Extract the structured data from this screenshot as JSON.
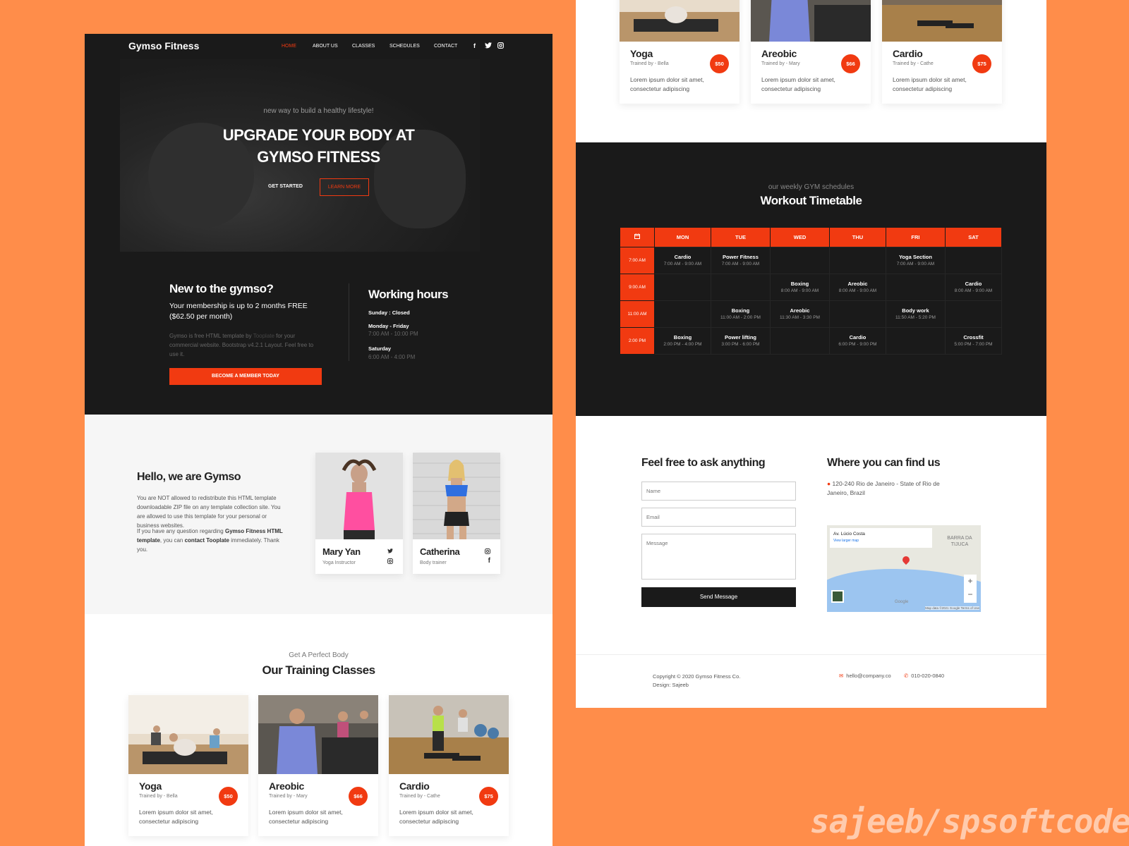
{
  "brand": "Gymso Fitness",
  "nav": {
    "items": [
      "HOME",
      "ABOUT US",
      "CLASSES",
      "SCHEDULES",
      "CONTACT"
    ],
    "social_icons": [
      "facebook-icon",
      "twitter-icon",
      "instagram-icon"
    ]
  },
  "hero": {
    "tagline": "new way to build a healthy lifestyle!",
    "title_line1": "UPGRADE YOUR BODY AT",
    "title_line2": "GYMSO FITNESS",
    "get_started": "GET STARTED",
    "learn_more": "LEARN MORE"
  },
  "membership": {
    "title": "New to the gymso?",
    "subtitle": "Your membership is up to 2 months FREE ($62.50 per month)",
    "desc_pre": "Gymso is free HTML template by ",
    "desc_link": "Tooplate",
    "desc_post": " for your commercial website. Bootstrap v4.2.1 Layout. Feel free to use it.",
    "button": "BECOME A MEMBER TODAY"
  },
  "hours": {
    "title": "Working hours",
    "sunday": "Sunday : Closed",
    "weekday_label": "Monday - Friday",
    "weekday_time": "7:00 AM - 10:00 PM",
    "saturday_label": "Saturday",
    "saturday_time": "6:00 AM - 4:00 PM"
  },
  "about": {
    "title": "Hello, we are Gymso",
    "p1": "You are NOT allowed to redistribute this HTML template downloadable ZIP file on any template collection site. You are allowed to use this template for your personal or business websites.",
    "p2_a": "If you have any question regarding ",
    "p2_b": "Gymso Fitness HTML template",
    "p2_c": ", you can ",
    "p2_d": "contact Tooplate",
    "p2_e": " immediately. Thank you.",
    "trainers": [
      {
        "name": "Mary Yan",
        "role": "Yoga Instructor",
        "icons": [
          "twitter-icon",
          "instagram-icon"
        ]
      },
      {
        "name": "Catherina",
        "role": "Body trainer",
        "icons": [
          "instagram-icon",
          "facebook-icon"
        ]
      }
    ]
  },
  "classes": {
    "subtitle": "Get A Perfect Body",
    "title": "Our Training Classes",
    "items": [
      {
        "name": "Yoga",
        "trainer": "Trained by - Bella",
        "price": "$50",
        "desc": "Lorem ipsum dolor sit amet, consectetur adipiscing"
      },
      {
        "name": "Areobic",
        "trainer": "Trained by - Mary",
        "price": "$66",
        "desc": "Lorem ipsum dolor sit amet, consectetur adipiscing"
      },
      {
        "name": "Cardio",
        "trainer": "Trained by - Cathe",
        "price": "$75",
        "desc": "Lorem ipsum dolor sit amet, consectetur adipiscing"
      }
    ]
  },
  "timetable": {
    "subtitle": "our weekly GYM schedules",
    "title": "Workout Timetable",
    "days": [
      "MON",
      "TUE",
      "WED",
      "THU",
      "FRI",
      "SAT"
    ],
    "rows": [
      {
        "time": "7:00 AM",
        "cells": [
          {
            "name": "Cardio",
            "time": "7:00 AM - 9:00 AM"
          },
          {
            "name": "Power Fitness",
            "time": "7:00 AM - 9:00 AM"
          },
          null,
          null,
          {
            "name": "Yoga Section",
            "time": "7:00 AM - 9:00 AM"
          },
          null
        ]
      },
      {
        "time": "9:00 AM",
        "cells": [
          null,
          null,
          {
            "name": "Boxing",
            "time": "8:00 AM - 9:00 AM"
          },
          {
            "name": "Areobic",
            "time": "8:00 AM - 9:00 AM"
          },
          null,
          {
            "name": "Cardio",
            "time": "8:00 AM - 9:00 AM"
          }
        ]
      },
      {
        "time": "11:00 AM",
        "cells": [
          null,
          {
            "name": "Boxing",
            "time": "11:00 AM - 2:00 PM"
          },
          {
            "name": "Areobic",
            "time": "11:30 AM - 3:30 PM"
          },
          null,
          {
            "name": "Body work",
            "time": "11:50 AM - 5:20 PM"
          },
          null
        ]
      },
      {
        "time": "2:00 PM",
        "cells": [
          {
            "name": "Boxing",
            "time": "2:00 PM - 4:00 PM"
          },
          {
            "name": "Power lifting",
            "time": "3:00 PM - 6:00 PM"
          },
          null,
          {
            "name": "Cardio",
            "time": "6:00 PM - 9:00 PM"
          },
          null,
          {
            "name": "Crossfit",
            "time": "5:00 PM - 7:00 PM"
          }
        ]
      }
    ]
  },
  "contact": {
    "title": "Feel free to ask anything",
    "name_placeholder": "Name",
    "email_placeholder": "Email",
    "message_placeholder": "Message",
    "send": "Send Message",
    "find_title": "Where you can find us",
    "address": "120-240 Rio de Janeiro - State of Rio de Janeiro, Brazil",
    "map_place": "Av. Lúcio Costa",
    "map_link": "View larger map",
    "map_region": "BARRA DA TIJUCA",
    "map_google": "Google",
    "map_data": "Map data ©2021 Google  Terms of Use"
  },
  "footer": {
    "copyright": "Copyright © 2020 Gymso Fitness Co.",
    "design": "Design: Sajeeb",
    "email": "hello@company.co",
    "phone": "010-020-0840"
  },
  "watermark": "sajeeb/spsoftcode",
  "colors": {
    "accent": "#F13A11",
    "dark": "#1a1a1a",
    "background": "#FF8D4A"
  }
}
